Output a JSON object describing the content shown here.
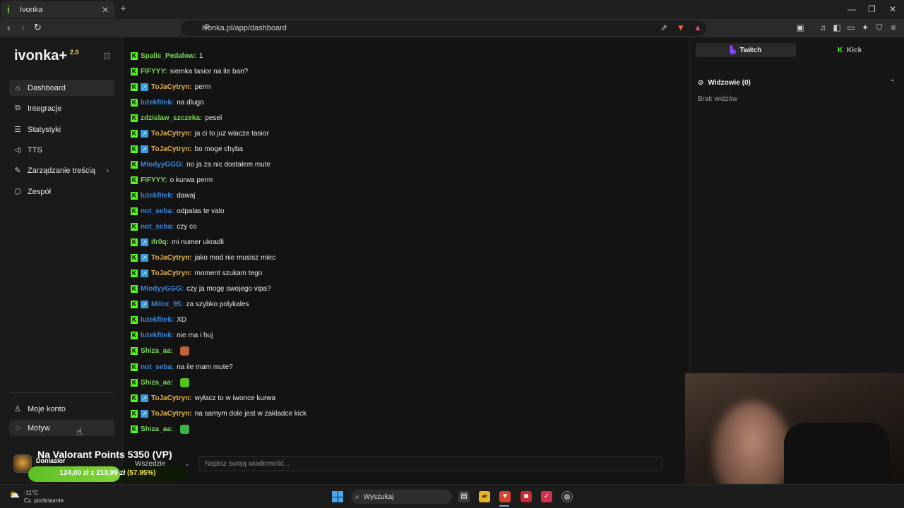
{
  "browser": {
    "tab_title": "Ivonka",
    "tab_favicon": "i",
    "url": "ivonka.pl/app/dashboard"
  },
  "sidebar": {
    "logo": "ivonka+",
    "logo_version": "2.0",
    "items": [
      {
        "label": "Dashboard",
        "icon": "home-icon",
        "glyph": "⌂"
      },
      {
        "label": "Integracje",
        "icon": "puzzle-icon",
        "glyph": "⧉"
      },
      {
        "label": "Statystyki",
        "icon": "chart-icon",
        "glyph": "☰"
      },
      {
        "label": "TTS",
        "icon": "speaker-icon",
        "glyph": "◁)"
      },
      {
        "label": "Zarządzanie treścią",
        "icon": "content-icon",
        "glyph": "✎",
        "chevron": "›"
      },
      {
        "label": "Zespół",
        "icon": "shield-icon",
        "glyph": "⬡"
      }
    ],
    "bottom_items": [
      {
        "label": "Moje konto",
        "icon": "user-icon",
        "glyph": "♙"
      },
      {
        "label": "Motyw",
        "icon": "palette-icon",
        "glyph": "◌"
      }
    ]
  },
  "chat": {
    "messages": [
      {
        "user": "Spalic_Pedalow:",
        "text": "1",
        "color": "#7bd65a",
        "twitch": false
      },
      {
        "user": "FIFYYY:",
        "text": "siemka tasior na ile ban?",
        "color": "#7bd65a",
        "twitch": false
      },
      {
        "user": "ToJaCytryn:",
        "text": "perm",
        "color": "#e3b44b",
        "twitch": true
      },
      {
        "user": "lutekfitek:",
        "text": "na dlugo",
        "color": "#3a86d8",
        "twitch": false
      },
      {
        "user": "zdzislaw_szczeka:",
        "text": "pesel",
        "color": "#7bd65a",
        "twitch": false
      },
      {
        "user": "ToJaCytryn:",
        "text": "ja ci to juz wlacze tasior",
        "color": "#e3b44b",
        "twitch": true
      },
      {
        "user": "ToJaCytryn:",
        "text": "bo moge chyba",
        "color": "#e3b44b",
        "twitch": true
      },
      {
        "user": "MlodyyGGG:",
        "text": "no ja za nic dostałem mute",
        "color": "#3a86d8",
        "twitch": false
      },
      {
        "user": "FIFYYY:",
        "text": "o kurwa perm",
        "color": "#7bd65a",
        "twitch": false
      },
      {
        "user": "lutekfitek:",
        "text": "dawaj",
        "color": "#3a86d8",
        "twitch": false
      },
      {
        "user": "not_seba:",
        "text": "odpalas te valo",
        "color": "#3a86d8",
        "twitch": false
      },
      {
        "user": "not_seba:",
        "text": "czy co",
        "color": "#3a86d8",
        "twitch": false
      },
      {
        "user": "ifr0q:",
        "text": "mi numer ukradli",
        "color": "#7bd65a",
        "twitch": true
      },
      {
        "user": "ToJaCytryn:",
        "text": "jako mod nie musisz miec",
        "color": "#e3b44b",
        "twitch": true
      },
      {
        "user": "ToJaCytryn:",
        "text": "moment szukam tego",
        "color": "#e3b44b",
        "twitch": true
      },
      {
        "user": "MlodyyGGG:",
        "text": "czy ja mogę swojego vipa?",
        "color": "#3a86d8",
        "twitch": false
      },
      {
        "user": "Milox_95:",
        "text": "za szybko polykales",
        "color": "#3a86d8",
        "twitch": true
      },
      {
        "user": "lutekfitek:",
        "text": "XD",
        "color": "#3a86d8",
        "twitch": false
      },
      {
        "user": "lutekfitek:",
        "text": "nie ma i huj",
        "color": "#3a86d8",
        "twitch": false
      },
      {
        "user": "Shiza_aa:",
        "text": "",
        "color": "#7bd65a",
        "twitch": false,
        "emote": "#c0623a"
      },
      {
        "user": "not_seba:",
        "text": "na ile mam mute?",
        "color": "#3a86d8",
        "twitch": false
      },
      {
        "user": "Shiza_aa:",
        "text": "",
        "color": "#7bd65a",
        "twitch": false,
        "emote": "#53c21e"
      },
      {
        "user": "ToJaCytryn:",
        "text": "wyłacz to w iwonce kurwa",
        "color": "#e3b44b",
        "twitch": true
      },
      {
        "user": "ToJaCytryn:",
        "text": "na samym dole jest w zakladce kick",
        "color": "#e3b44b",
        "twitch": true
      },
      {
        "user": "Shiza_aa:",
        "text": "",
        "color": "#7bd65a",
        "twitch": false,
        "emote": "#3bb24a"
      }
    ],
    "input_placeholder": "Napisz swoją wiadomość...",
    "scope": "Wszędzie"
  },
  "panel": {
    "tab_twitch": "Twitch",
    "tab_kick": "Kick",
    "viewers_label": "Widzowie (0)",
    "viewers_empty": "Brak widzów"
  },
  "donation": {
    "title": "Na Valorant Points 5350 (VP)",
    "user": "Donlasior",
    "progress_text": "124,00 zł  z  213,99 zł",
    "percent_text": "(57.95%)",
    "percent": 57.95
  },
  "taskbar": {
    "weather_temp": "-11°C",
    "weather_desc": "Cz. pochmurnie",
    "search_label": "Wyszukaj"
  },
  "colors": {
    "kick_green": "#53fc18",
    "twitch_purple": "#9146ff",
    "accent_yellow": "#f2e44b"
  }
}
